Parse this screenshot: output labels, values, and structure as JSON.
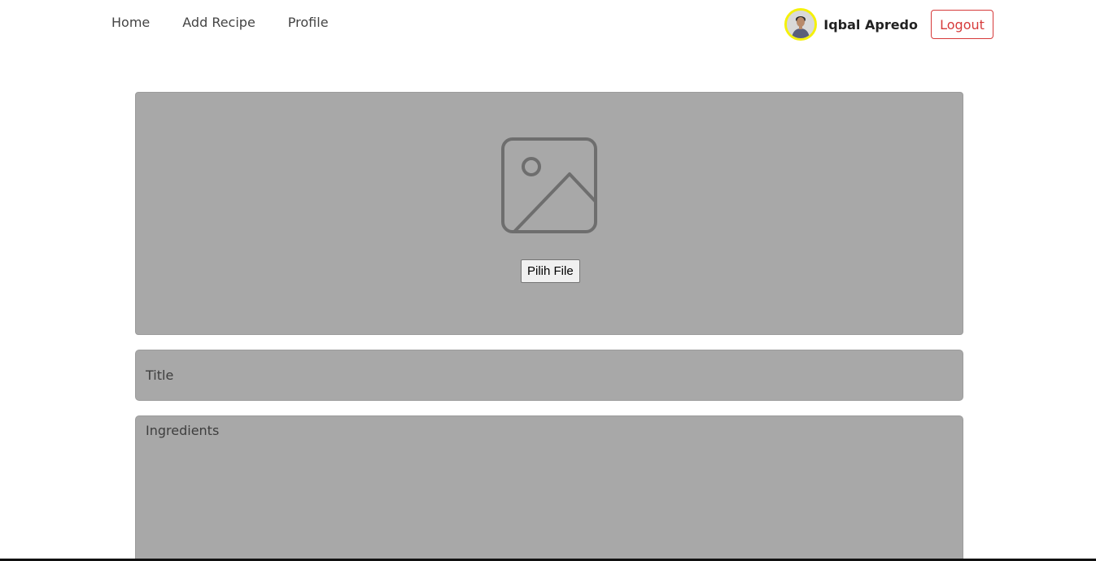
{
  "nav": {
    "home_label": "Home",
    "add_recipe_label": "Add Recipe",
    "profile_label": "Profile"
  },
  "user": {
    "name": "Iqbal Apredo",
    "logout_label": "Logout",
    "avatar_icon": "user-avatar-photo"
  },
  "form": {
    "image_icon": "image-placeholder-icon",
    "file_button_label": "Pilih File",
    "title_placeholder": "Title",
    "ingredients_placeholder": "Ingredients"
  },
  "colors": {
    "field_background": "#a8a8a8",
    "logout_accent": "#d63a3a",
    "avatar_ring": "#f5f10a"
  }
}
